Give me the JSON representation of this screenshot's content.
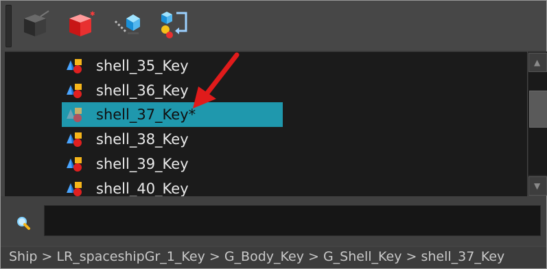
{
  "toolbar": {
    "buttons": [
      {
        "name": "cube-grey-icon"
      },
      {
        "name": "cube-red-new-icon"
      },
      {
        "name": "link-node-icon"
      },
      {
        "name": "swap-shape-icon"
      }
    ]
  },
  "list": {
    "items": [
      {
        "label": "shell_35_Key",
        "selected": false
      },
      {
        "label": "shell_36_Key",
        "selected": false
      },
      {
        "label": "shell_37_Key*",
        "selected": true
      },
      {
        "label": "shell_38_Key",
        "selected": false
      },
      {
        "label": "shell_39_Key",
        "selected": false
      },
      {
        "label": "shell_40_Key",
        "selected": false
      }
    ]
  },
  "search": {
    "value": "",
    "placeholder": ""
  },
  "breadcrumb": {
    "path": "Ship > LR_spaceshipGr_1_Key > G_Body_Key > G_Shell_Key > shell_37_Key"
  },
  "colors": {
    "selection": "#1f98ad",
    "arrow": "#e01b1b"
  }
}
